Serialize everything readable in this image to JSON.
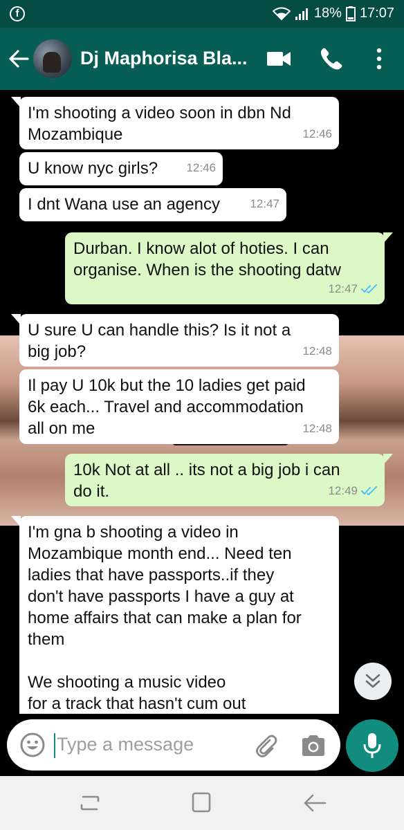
{
  "status_bar": {
    "battery": "18%",
    "time": "17:07",
    "app_icon": "facebook-icon"
  },
  "header": {
    "contact_name": "Dj Maphorisa Bla..."
  },
  "messages": [
    {
      "dir": "in",
      "text": "I'm shooting a video soon in dbn Nd\nMozambique",
      "time": "12:46"
    },
    {
      "dir": "in",
      "text": "U know nyc girls?",
      "time": "12:46"
    },
    {
      "dir": "in",
      "text": "I dnt Wana use an agency",
      "time": "12:47"
    },
    {
      "dir": "out",
      "text": "Durban. I know alot of hoties. I can\norganise. When is the shooting datw",
      "time": "12:47",
      "status": "read"
    },
    {
      "dir": "in",
      "text": "U sure U can handle this? Is it not a\nbig job?",
      "time": "12:48"
    },
    {
      "dir": "in",
      "text": "Il pay U 10k but the 10 ladies get paid\n6k each... Travel and accommodation\nall on me",
      "time": "12:48"
    },
    {
      "dir": "out",
      "text": "10k Not at all .. its not a big job i can\ndo it.",
      "time": "12:49",
      "status": "read"
    },
    {
      "dir": "in",
      "text": "I'm gna b shooting a video in\nMozambique month end... Need ten\nladies that have passports..if they\ndon't have passports I have a guy at\nhome affairs that can make a plan for\nthem\n\nWe shooting a music video\nfor a track that hasn't cum out",
      "time": ""
    }
  ],
  "composer": {
    "placeholder": "Type a message"
  },
  "colors": {
    "header": "#075e54",
    "status_bar": "#054d44",
    "outgoing": "#dcf8c6",
    "incoming": "#ffffff",
    "accent": "#128c7e",
    "read_ticks": "#4fc3f7"
  }
}
